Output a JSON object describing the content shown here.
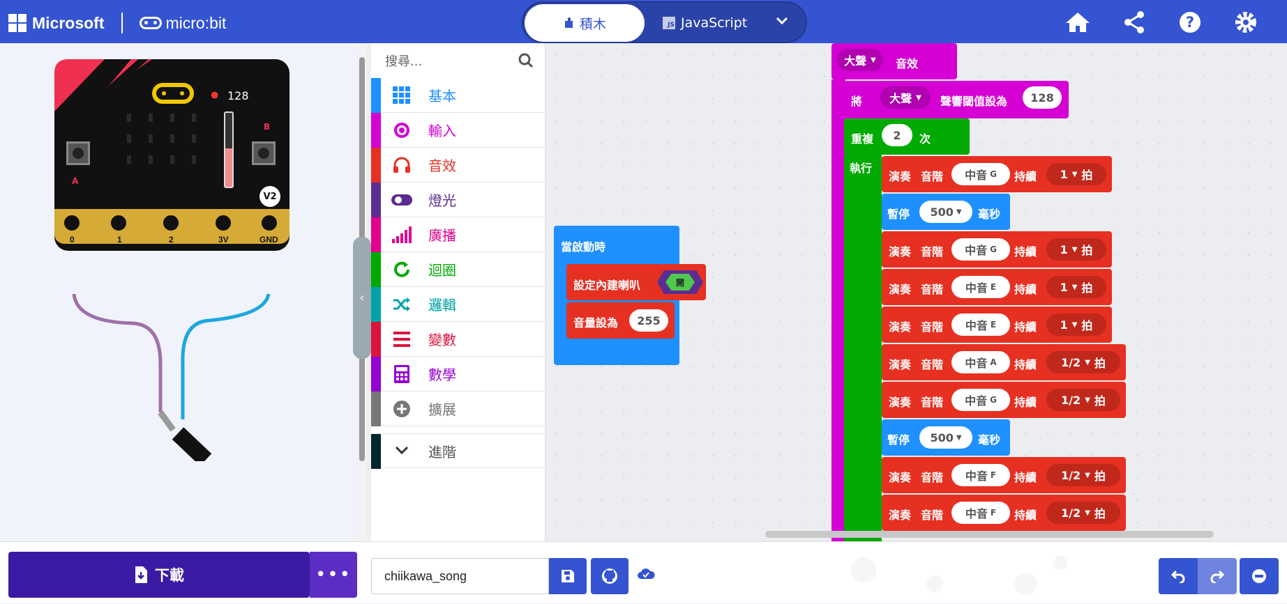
{
  "header": {
    "brand": "Microsoft",
    "product": "micro:bit",
    "tab_blocks": "積木",
    "tab_js": "JavaScript",
    "js_badge": "JS",
    "icons": [
      "home-icon",
      "share-icon",
      "help-icon",
      "settings-icon"
    ]
  },
  "simulator": {
    "sound_level": "128",
    "version": "V2",
    "button_a": "A",
    "button_b": "B",
    "pins": [
      "0",
      "1",
      "2",
      "3V",
      "GND"
    ]
  },
  "search": {
    "placeholder": "搜尋..."
  },
  "toolbox": [
    {
      "label": "基本",
      "color": "#1e90ff",
      "icon": "grid-icon"
    },
    {
      "label": "輸入",
      "color": "#d400d4",
      "icon": "target-icon"
    },
    {
      "label": "音效",
      "color": "#e63022",
      "icon": "headphones-icon"
    },
    {
      "label": "燈光",
      "color": "#5c2d91",
      "icon": "toggle-icon"
    },
    {
      "label": "廣播",
      "color": "#e3008c",
      "icon": "signal-icon"
    },
    {
      "label": "迴圈",
      "color": "#00aa00",
      "icon": "loop-icon"
    },
    {
      "label": "邏輯",
      "color": "#00a4a6",
      "icon": "shuffle-icon"
    },
    {
      "label": "變數",
      "color": "#dc143c",
      "icon": "list-icon"
    },
    {
      "label": "數學",
      "color": "#9400d3",
      "icon": "calculator-icon"
    },
    {
      "label": "擴展",
      "color": "#777777",
      "icon": "plus-icon"
    }
  ],
  "advanced": {
    "label": "進階",
    "color": "#00272b"
  },
  "workspace": {
    "on_start": {
      "title": "當啟動時",
      "speaker": "設定內建喇叭",
      "speaker_state": "開",
      "volume_label": "音量設為",
      "volume": "255"
    },
    "loud": {
      "option": "大聲",
      "label": "音效"
    },
    "threshold": {
      "prefix": "將",
      "option": "大聲",
      "label": "聲響閾值設為",
      "value": "128"
    },
    "repeat": {
      "label": "重複",
      "count": "2",
      "times": "次",
      "do": "執行"
    },
    "steps": [
      {
        "kind": "play",
        "note": "中音",
        "letter": "G",
        "beat": "1"
      },
      {
        "kind": "pause",
        "ms": "500"
      },
      {
        "kind": "play",
        "note": "中音",
        "letter": "G",
        "beat": "1"
      },
      {
        "kind": "play",
        "note": "中音",
        "letter": "E",
        "beat": "1"
      },
      {
        "kind": "play",
        "note": "中音",
        "letter": "E",
        "beat": "1"
      },
      {
        "kind": "play",
        "note": "中音",
        "letter": "A",
        "beat": "1/2"
      },
      {
        "kind": "play",
        "note": "中音",
        "letter": "G",
        "beat": "1/2"
      },
      {
        "kind": "pause",
        "ms": "500"
      },
      {
        "kind": "play",
        "note": "中音",
        "letter": "F",
        "beat": "1/2"
      },
      {
        "kind": "play",
        "note": "中音",
        "letter": "F",
        "beat": "1/2"
      }
    ],
    "play_words": {
      "play": "演奏",
      "pitch": "音階",
      "dur": "持續",
      "beat_unit": "拍",
      "pause": "暫停",
      "ms_unit": "毫秒"
    }
  },
  "bottom": {
    "download": "下載",
    "project_name": "chiikawa_song"
  },
  "colors": {
    "header": "#3454d1",
    "sound_red": "#e63022",
    "input_magenta": "#d400d4",
    "loop_green": "#00aa00",
    "basic_blue": "#1e90ff"
  }
}
